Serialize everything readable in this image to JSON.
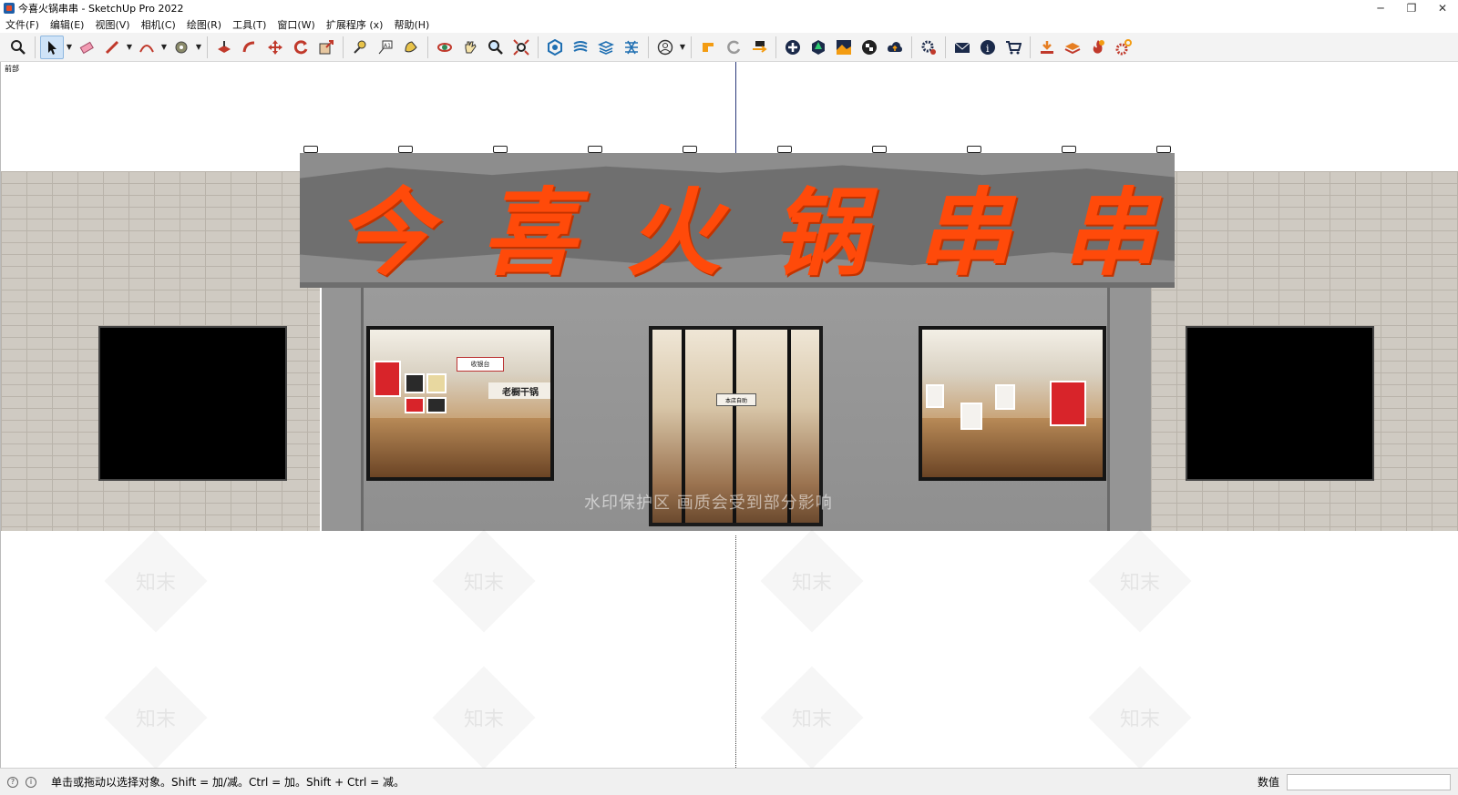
{
  "window": {
    "title": "今喜火锅串串 - SketchUp Pro 2022",
    "minimize": "─",
    "restore": "❐",
    "close": "✕"
  },
  "menu": [
    {
      "label": "文件(F)"
    },
    {
      "label": "编辑(E)"
    },
    {
      "label": "视图(V)"
    },
    {
      "label": "相机(C)"
    },
    {
      "label": "绘图(R)"
    },
    {
      "label": "工具(T)"
    },
    {
      "label": "窗口(W)"
    },
    {
      "label": "扩展程序 (x)"
    },
    {
      "label": "帮助(H)"
    }
  ],
  "toolbar": {
    "icons": [
      "zoom-search-icon",
      "select-arrow-icon",
      "eraser-icon",
      "pencil-line-icon",
      "arc-icon",
      "paint-bucket-icon",
      "push-pull-icon",
      "follow-me-icon",
      "move-icon",
      "rotate-icon",
      "scale-icon",
      "tape-measure-icon",
      "text-icon",
      "paint-icon",
      "orbit-icon",
      "pan-icon",
      "zoom-icon",
      "zoom-extents-icon",
      "component-icon",
      "styles-icon",
      "layers-icon",
      "scenes-icon",
      "account-icon",
      "extension-warehouse-icon",
      "sync-icon",
      "export-icon",
      "add-icon",
      "tree-icon",
      "terrain-icon",
      "checker-icon",
      "cloud-upload-icon",
      "settings-icon",
      "mail-icon",
      "info-icon",
      "cart-icon",
      "import-icon",
      "sandbox-icon",
      "fire-icon",
      "gear-orange-icon"
    ]
  },
  "viewport": {
    "view_label": "前部",
    "sign_characters": [
      "今",
      "喜",
      "火",
      "锅",
      "串",
      "串"
    ],
    "counter_sign": "收银台",
    "kitchen_sign": "老橱干锅",
    "door_sign": "本店自助",
    "watermark": "水印保护区   画质会受到部分影响",
    "wm_logo": "知末"
  },
  "status": {
    "text": "单击或拖动以选择对象。Shift = 加/减。Ctrl = 加。Shift + Ctrl = 减。",
    "vcb_label": "数值",
    "vcb_value": ""
  },
  "colors": {
    "sign_text": "#ff4a0a",
    "active_tool": "#cfe3f7"
  }
}
